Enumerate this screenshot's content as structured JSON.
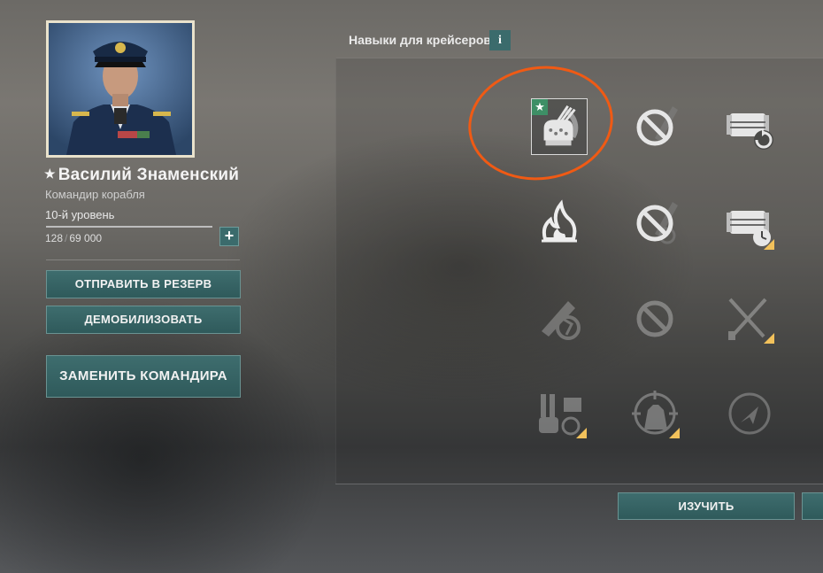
{
  "commander": {
    "name": "Василий Знаменский",
    "role": "Командир корабля",
    "level": "10-й уровень",
    "xp_current": "128",
    "xp_total": "69 000",
    "xp_progress": 0.002
  },
  "actions": {
    "reserve_label": "Отправить в резерв",
    "demobilize_label": "Демобилизовать",
    "replace_label": "Заменить командира",
    "learn_label": "Изучить"
  },
  "skills_panel": {
    "title": "Навыки для крейсеров",
    "info_label": "i"
  },
  "skills": [
    {
      "icon": "gun-turret-skill-icon",
      "row": 1,
      "col": 1,
      "state": "selected",
      "starred": true
    },
    {
      "icon": "disabled-skill-icon",
      "row": 1,
      "col": 2,
      "state": "available"
    },
    {
      "icon": "consumable-reload-icon",
      "row": 1,
      "col": 3,
      "state": "available"
    },
    {
      "icon": "fire-icon",
      "row": 2,
      "col": 1,
      "state": "available"
    },
    {
      "icon": "disabled-skill-icon",
      "row": 2,
      "col": 2,
      "state": "available"
    },
    {
      "icon": "consumable-timer-icon",
      "row": 2,
      "col": 3,
      "state": "available",
      "upgrade_marker": true
    },
    {
      "icon": "torpedo-skill-icon",
      "row": 3,
      "col": 1,
      "state": "locked"
    },
    {
      "icon": "disabled-skill-icon",
      "row": 3,
      "col": 2,
      "state": "locked"
    },
    {
      "icon": "crossed-swords-icon",
      "row": 3,
      "col": 3,
      "state": "locked",
      "upgrade_marker": true
    },
    {
      "icon": "turret-traverse-icon",
      "row": 4,
      "col": 1,
      "state": "locked",
      "upgrade_marker": true
    },
    {
      "icon": "target-tower-icon",
      "row": 4,
      "col": 2,
      "state": "locked",
      "upgrade_marker": true
    },
    {
      "icon": "radar-icon",
      "row": 4,
      "col": 3,
      "state": "locked"
    }
  ],
  "colors": {
    "button": "#3e6d6e",
    "star_badge": "#3e8f66",
    "upgrade_marker": "#f2c15b",
    "annotation": "#f05a14"
  }
}
